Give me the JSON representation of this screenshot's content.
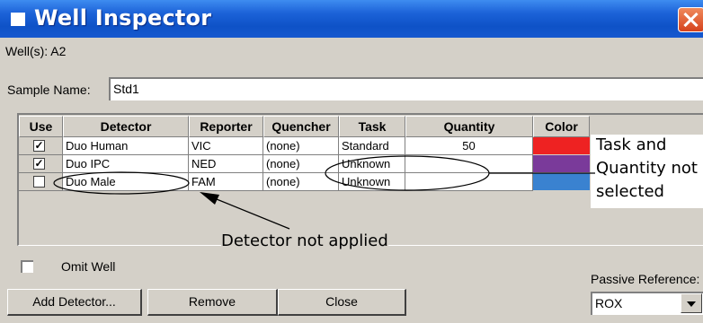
{
  "window": {
    "title": "Well Inspector"
  },
  "wells_label": "Well(s): A2",
  "sample_name": {
    "label": "Sample Name:",
    "value": "Std1"
  },
  "table": {
    "headers": [
      "Use",
      "Detector",
      "Reporter",
      "Quencher",
      "Task",
      "Quantity",
      "Color"
    ],
    "rows": [
      {
        "use": true,
        "detector": "Duo Human",
        "reporter": "VIC",
        "quencher": "(none)",
        "task": "Standard",
        "quantity": "50",
        "color": "#ee2222"
      },
      {
        "use": true,
        "detector": "Duo IPC",
        "reporter": "NED",
        "quencher": "(none)",
        "task": "Unknown",
        "quantity": "",
        "color": "#7a3a9a"
      },
      {
        "use": false,
        "detector": "Duo Male",
        "reporter": "FAM",
        "quencher": "(none)",
        "task": "Unknown",
        "quantity": "",
        "color": "#3a82d0"
      }
    ]
  },
  "annotations": {
    "task_quantity": [
      "Task and",
      "Quantity not",
      "selected"
    ],
    "detector": "Detector not applied"
  },
  "omit_well": {
    "label": "Omit Well",
    "checked": false
  },
  "passive_reference": {
    "label": "Passive Reference:",
    "value": "ROX"
  },
  "buttons": {
    "add_detector": "Add Detector...",
    "remove": "Remove",
    "close": "Close"
  },
  "check_mark": "✓"
}
